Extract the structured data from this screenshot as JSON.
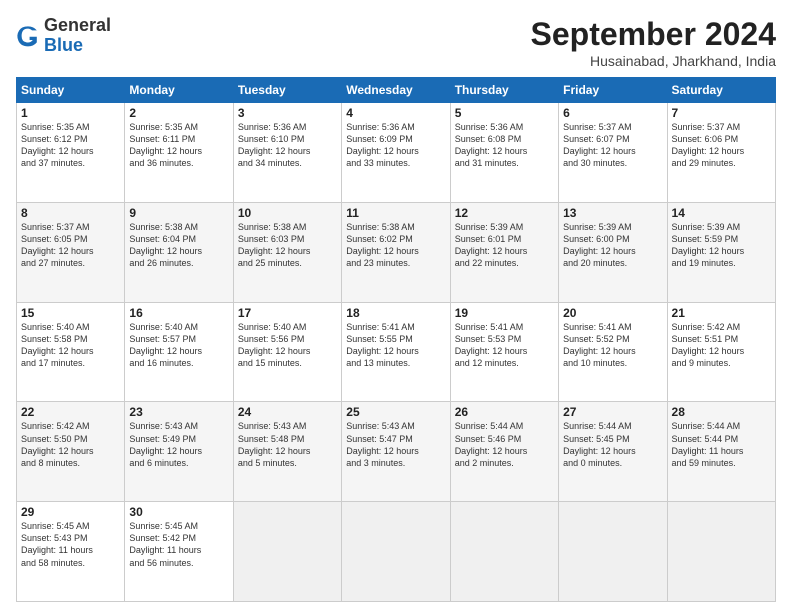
{
  "header": {
    "logo": {
      "line1": "General",
      "line2": "Blue"
    },
    "title": "September 2024",
    "location": "Husainabad, Jharkhand, India"
  },
  "columns": [
    "Sunday",
    "Monday",
    "Tuesday",
    "Wednesday",
    "Thursday",
    "Friday",
    "Saturday"
  ],
  "rows": [
    [
      {
        "day": "1",
        "lines": [
          "Sunrise: 5:35 AM",
          "Sunset: 6:12 PM",
          "Daylight: 12 hours",
          "and 37 minutes."
        ]
      },
      {
        "day": "2",
        "lines": [
          "Sunrise: 5:35 AM",
          "Sunset: 6:11 PM",
          "Daylight: 12 hours",
          "and 36 minutes."
        ]
      },
      {
        "day": "3",
        "lines": [
          "Sunrise: 5:36 AM",
          "Sunset: 6:10 PM",
          "Daylight: 12 hours",
          "and 34 minutes."
        ]
      },
      {
        "day": "4",
        "lines": [
          "Sunrise: 5:36 AM",
          "Sunset: 6:09 PM",
          "Daylight: 12 hours",
          "and 33 minutes."
        ]
      },
      {
        "day": "5",
        "lines": [
          "Sunrise: 5:36 AM",
          "Sunset: 6:08 PM",
          "Daylight: 12 hours",
          "and 31 minutes."
        ]
      },
      {
        "day": "6",
        "lines": [
          "Sunrise: 5:37 AM",
          "Sunset: 6:07 PM",
          "Daylight: 12 hours",
          "and 30 minutes."
        ]
      },
      {
        "day": "7",
        "lines": [
          "Sunrise: 5:37 AM",
          "Sunset: 6:06 PM",
          "Daylight: 12 hours",
          "and 29 minutes."
        ]
      }
    ],
    [
      {
        "day": "8",
        "lines": [
          "Sunrise: 5:37 AM",
          "Sunset: 6:05 PM",
          "Daylight: 12 hours",
          "and 27 minutes."
        ]
      },
      {
        "day": "9",
        "lines": [
          "Sunrise: 5:38 AM",
          "Sunset: 6:04 PM",
          "Daylight: 12 hours",
          "and 26 minutes."
        ]
      },
      {
        "day": "10",
        "lines": [
          "Sunrise: 5:38 AM",
          "Sunset: 6:03 PM",
          "Daylight: 12 hours",
          "and 25 minutes."
        ]
      },
      {
        "day": "11",
        "lines": [
          "Sunrise: 5:38 AM",
          "Sunset: 6:02 PM",
          "Daylight: 12 hours",
          "and 23 minutes."
        ]
      },
      {
        "day": "12",
        "lines": [
          "Sunrise: 5:39 AM",
          "Sunset: 6:01 PM",
          "Daylight: 12 hours",
          "and 22 minutes."
        ]
      },
      {
        "day": "13",
        "lines": [
          "Sunrise: 5:39 AM",
          "Sunset: 6:00 PM",
          "Daylight: 12 hours",
          "and 20 minutes."
        ]
      },
      {
        "day": "14",
        "lines": [
          "Sunrise: 5:39 AM",
          "Sunset: 5:59 PM",
          "Daylight: 12 hours",
          "and 19 minutes."
        ]
      }
    ],
    [
      {
        "day": "15",
        "lines": [
          "Sunrise: 5:40 AM",
          "Sunset: 5:58 PM",
          "Daylight: 12 hours",
          "and 17 minutes."
        ]
      },
      {
        "day": "16",
        "lines": [
          "Sunrise: 5:40 AM",
          "Sunset: 5:57 PM",
          "Daylight: 12 hours",
          "and 16 minutes."
        ]
      },
      {
        "day": "17",
        "lines": [
          "Sunrise: 5:40 AM",
          "Sunset: 5:56 PM",
          "Daylight: 12 hours",
          "and 15 minutes."
        ]
      },
      {
        "day": "18",
        "lines": [
          "Sunrise: 5:41 AM",
          "Sunset: 5:55 PM",
          "Daylight: 12 hours",
          "and 13 minutes."
        ]
      },
      {
        "day": "19",
        "lines": [
          "Sunrise: 5:41 AM",
          "Sunset: 5:53 PM",
          "Daylight: 12 hours",
          "and 12 minutes."
        ]
      },
      {
        "day": "20",
        "lines": [
          "Sunrise: 5:41 AM",
          "Sunset: 5:52 PM",
          "Daylight: 12 hours",
          "and 10 minutes."
        ]
      },
      {
        "day": "21",
        "lines": [
          "Sunrise: 5:42 AM",
          "Sunset: 5:51 PM",
          "Daylight: 12 hours",
          "and 9 minutes."
        ]
      }
    ],
    [
      {
        "day": "22",
        "lines": [
          "Sunrise: 5:42 AM",
          "Sunset: 5:50 PM",
          "Daylight: 12 hours",
          "and 8 minutes."
        ]
      },
      {
        "day": "23",
        "lines": [
          "Sunrise: 5:43 AM",
          "Sunset: 5:49 PM",
          "Daylight: 12 hours",
          "and 6 minutes."
        ]
      },
      {
        "day": "24",
        "lines": [
          "Sunrise: 5:43 AM",
          "Sunset: 5:48 PM",
          "Daylight: 12 hours",
          "and 5 minutes."
        ]
      },
      {
        "day": "25",
        "lines": [
          "Sunrise: 5:43 AM",
          "Sunset: 5:47 PM",
          "Daylight: 12 hours",
          "and 3 minutes."
        ]
      },
      {
        "day": "26",
        "lines": [
          "Sunrise: 5:44 AM",
          "Sunset: 5:46 PM",
          "Daylight: 12 hours",
          "and 2 minutes."
        ]
      },
      {
        "day": "27",
        "lines": [
          "Sunrise: 5:44 AM",
          "Sunset: 5:45 PM",
          "Daylight: 12 hours",
          "and 0 minutes."
        ]
      },
      {
        "day": "28",
        "lines": [
          "Sunrise: 5:44 AM",
          "Sunset: 5:44 PM",
          "Daylight: 11 hours",
          "and 59 minutes."
        ]
      }
    ],
    [
      {
        "day": "29",
        "lines": [
          "Sunrise: 5:45 AM",
          "Sunset: 5:43 PM",
          "Daylight: 11 hours",
          "and 58 minutes."
        ]
      },
      {
        "day": "30",
        "lines": [
          "Sunrise: 5:45 AM",
          "Sunset: 5:42 PM",
          "Daylight: 11 hours",
          "and 56 minutes."
        ]
      },
      {
        "day": "",
        "lines": []
      },
      {
        "day": "",
        "lines": []
      },
      {
        "day": "",
        "lines": []
      },
      {
        "day": "",
        "lines": []
      },
      {
        "day": "",
        "lines": []
      }
    ]
  ]
}
